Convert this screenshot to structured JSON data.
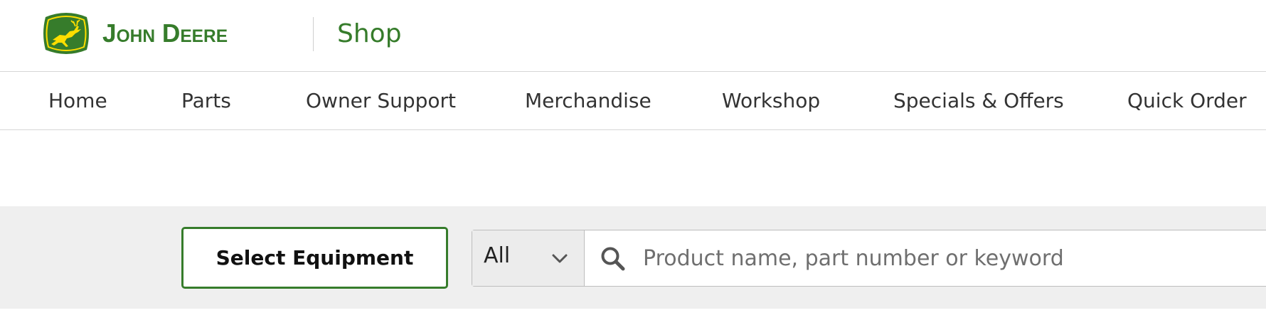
{
  "header": {
    "brand": "John Deere",
    "section": "Shop",
    "logo_icon": "leaping-deer-logo-icon",
    "brand_color": "#367c2b",
    "logo_accent": "#ffde00"
  },
  "nav": {
    "items": [
      {
        "label": "Home"
      },
      {
        "label": "Parts"
      },
      {
        "label": "Owner Support"
      },
      {
        "label": "Merchandise"
      },
      {
        "label": "Workshop"
      },
      {
        "label": "Specials & Offers"
      },
      {
        "label": "Quick Order"
      }
    ]
  },
  "search": {
    "select_equipment_label": "Select Equipment",
    "scope_value": "All",
    "scope_icon": "chevron-down-icon",
    "search_icon": "search-icon",
    "placeholder": "Product name, part number or keyword"
  }
}
